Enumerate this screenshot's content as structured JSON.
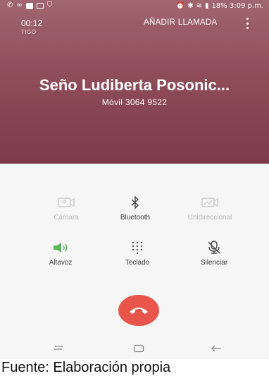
{
  "status_bar": {
    "right_text": "18% 3:09 p.m."
  },
  "call": {
    "timer": "00:12",
    "carrier": "TIGO",
    "add_call_label": "AÑADIR LLAMADA",
    "contact_name": "Seño Ludiberta Posonic...",
    "contact_number_line": "Móvil  3064 9522"
  },
  "controls": [
    {
      "label": "Cámara",
      "icon": "camera-icon",
      "enabled": false
    },
    {
      "label": "Bluetooth",
      "icon": "bluetooth-icon",
      "enabled": true
    },
    {
      "label": "Unidireccional",
      "icon": "one-way-video-icon",
      "enabled": false
    },
    {
      "label": "Altavoz",
      "icon": "speaker-icon",
      "enabled": true,
      "active": true
    },
    {
      "label": "Teclado",
      "icon": "keypad-icon",
      "enabled": true
    },
    {
      "label": "Silenciar",
      "icon": "mute-icon",
      "enabled": true
    }
  ],
  "colors": {
    "header_top": "#a06670",
    "header_bottom": "#7c3b48",
    "end_call": "#e9554b",
    "speaker_active": "#5cb85c"
  },
  "caption": "Fuente: Elaboración propia"
}
